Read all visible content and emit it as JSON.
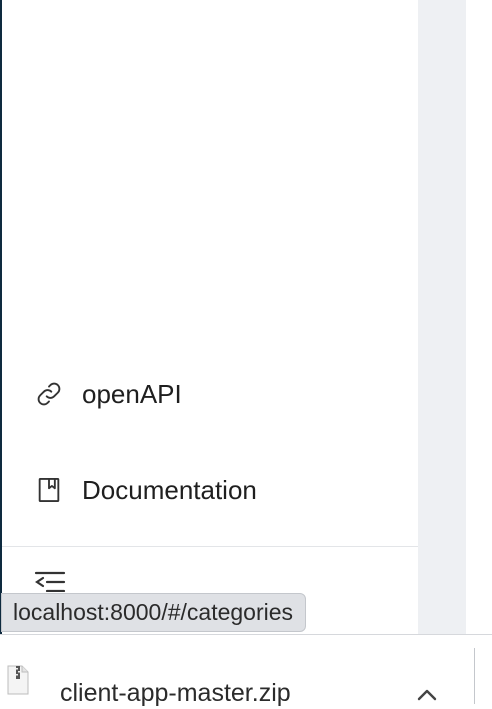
{
  "sidebar": {
    "items": [
      {
        "label": "openAPI",
        "icon": "link-icon"
      },
      {
        "label": "Documentation",
        "icon": "bookmark-icon"
      }
    ],
    "collapse_icon": "collapse-menu-icon"
  },
  "status_bar": {
    "url": "localhost:8000/#/categories"
  },
  "download_bar": {
    "file_name": "client-app-master.zip",
    "file_icon": "zip-file-icon",
    "menu_icon": "chevron-up-icon"
  }
}
